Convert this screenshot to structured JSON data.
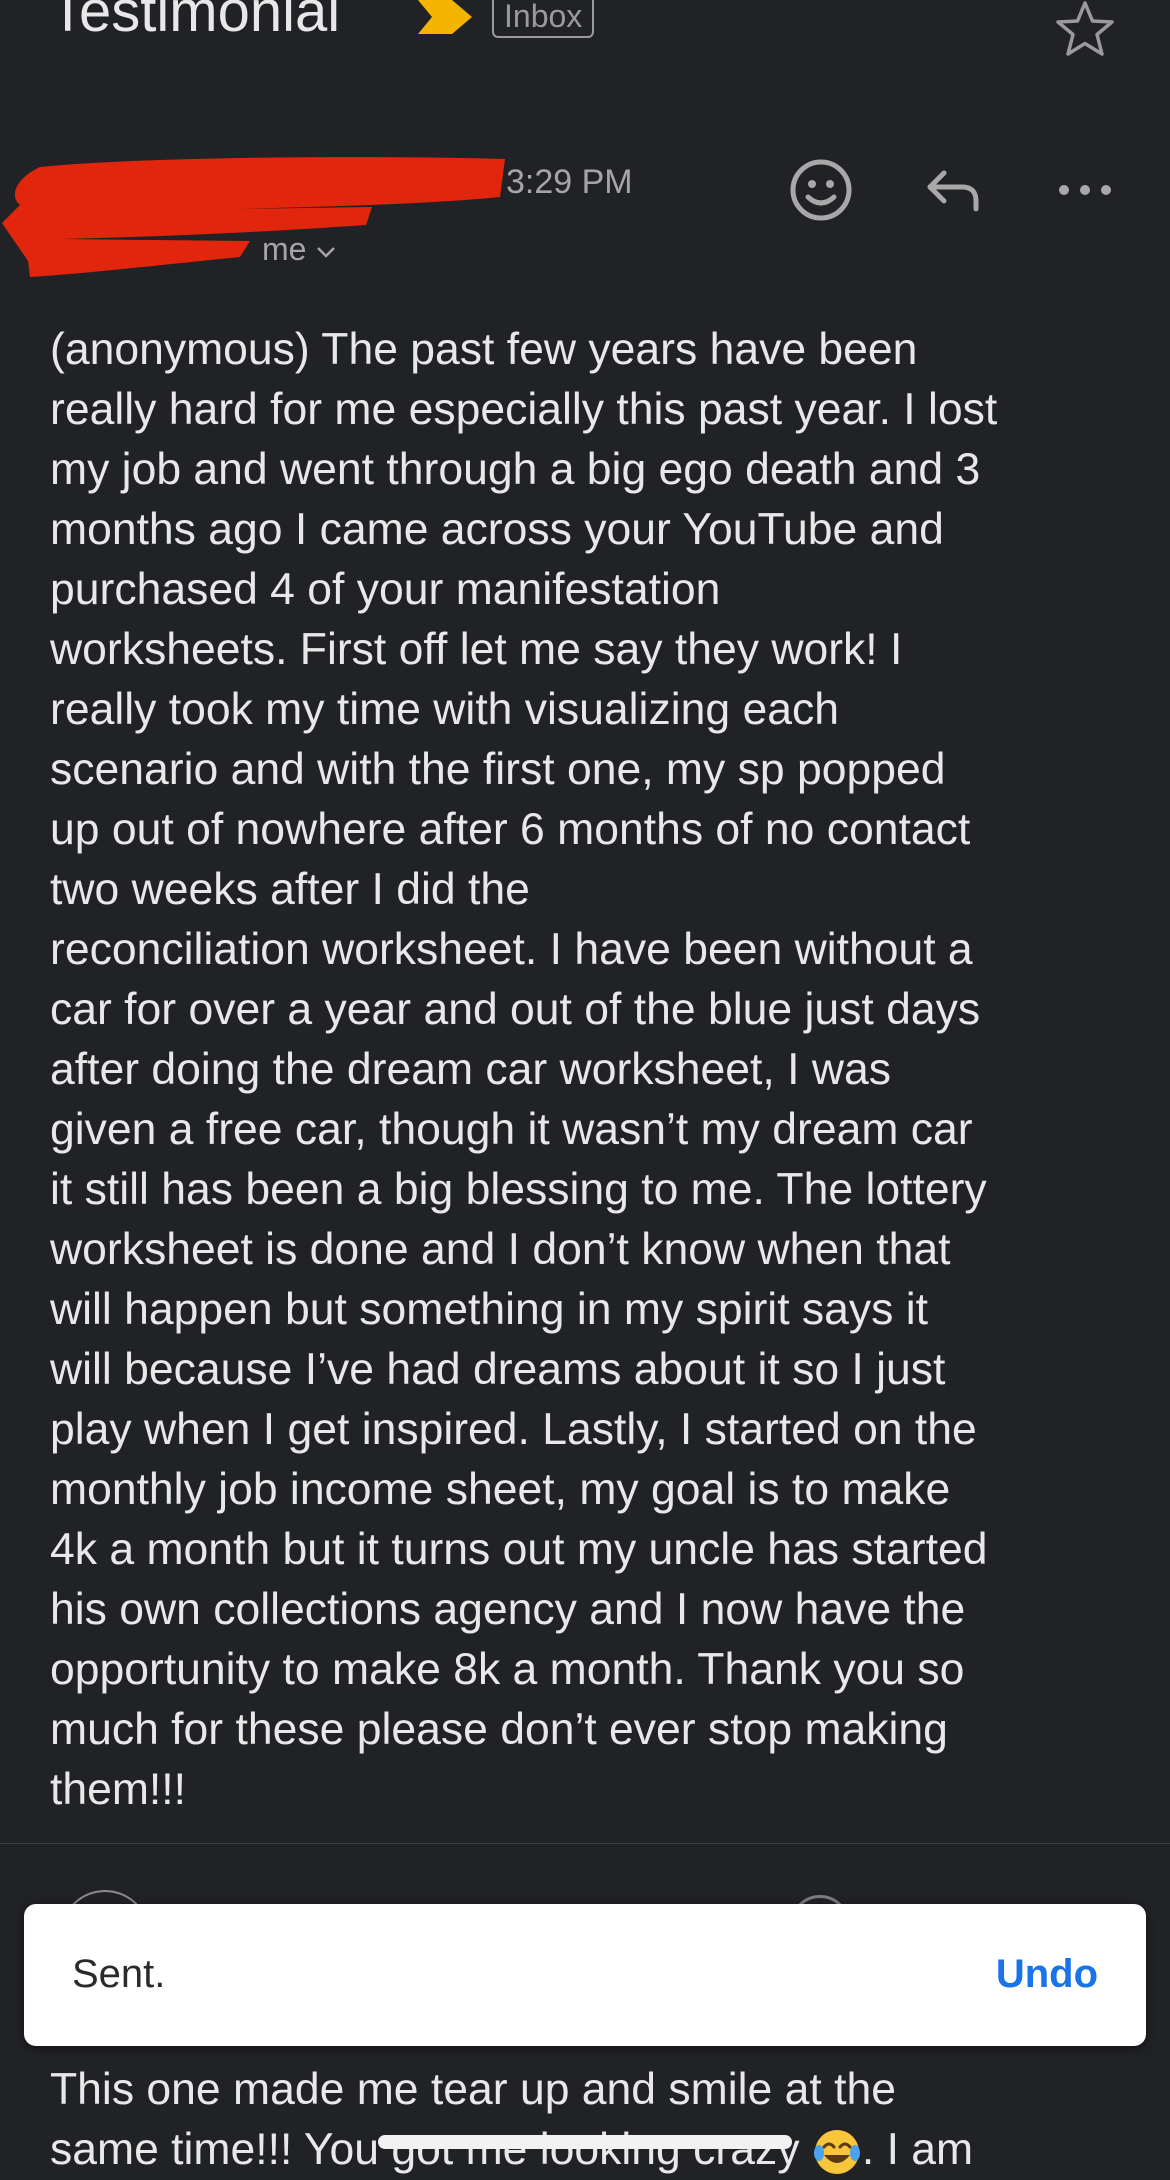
{
  "header": {
    "subject": "Testimonial",
    "label": "Inbox",
    "important_icon": "important-marker-icon",
    "star_icon": "star-icon"
  },
  "message": {
    "time": "3:29 PM",
    "recipient": "me",
    "actions": [
      "emoji-reaction-icon",
      "reply-icon",
      "more-options-icon"
    ],
    "body": "(anonymous) The past few years have been\nreally hard for me especially this past year. I lost\nmy job and went through a big ego death and 3\nmonths ago I came across your YouTube and\npurchased 4 of your manifestation\nworksheets. First off let me say they work! I\nreally took my time with visualizing each\nscenario and with the first one, my sp popped\nup out of nowhere after 6 months of no contact\ntwo weeks after I did the\nreconciliation worksheet. I have been without a\ncar for over a year and out of the blue just days\nafter doing the dream car worksheet, I was\ngiven a free car, though it wasn’t my dream car\nit still has been a big blessing to me. The lottery\nworksheet is done and I don’t know when that\nwill happen but something in my spirit says it\nwill because I’ve had dreams about it so I just\nplay when I get inspired. Lastly, I started on the\nmonthly job income sheet, my goal is to make\n4k a month but it turns out my uncle has started\nhis own collections agency and I now have the\nopportunity to make 8k a month. Thank you so\nmuch for these please don’t ever stop making\nthem!!!"
  },
  "snackbar": {
    "text": "Sent.",
    "action": "Undo"
  },
  "next_message": {
    "line1": "This one made me tear up and smile at the",
    "line2_before": "same time!!! You got me looking crazy",
    "line2_after": ". I am",
    "emoji_icon": "laughing-crying-emoji-icon"
  },
  "colors": {
    "background": "#212226",
    "important_marker": "#f4b400",
    "redaction": "#e1260d",
    "undo": "#1a73e8"
  }
}
